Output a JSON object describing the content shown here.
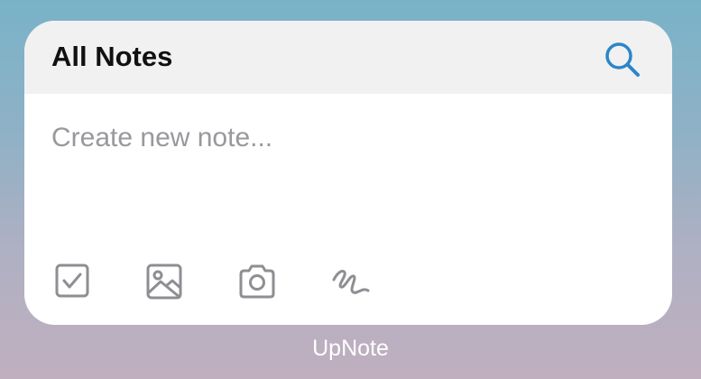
{
  "widget": {
    "title": "All Notes",
    "search_icon": "search-icon",
    "accent_color": "#2a86c9",
    "input_placeholder": "Create new note...",
    "toolbar": [
      {
        "icon": "checkbox-icon",
        "label": "checklist"
      },
      {
        "icon": "image-icon",
        "label": "photo library"
      },
      {
        "icon": "camera-icon",
        "label": "camera"
      },
      {
        "icon": "scribble-icon",
        "label": "drawing"
      }
    ]
  },
  "app_name": "UpNote"
}
